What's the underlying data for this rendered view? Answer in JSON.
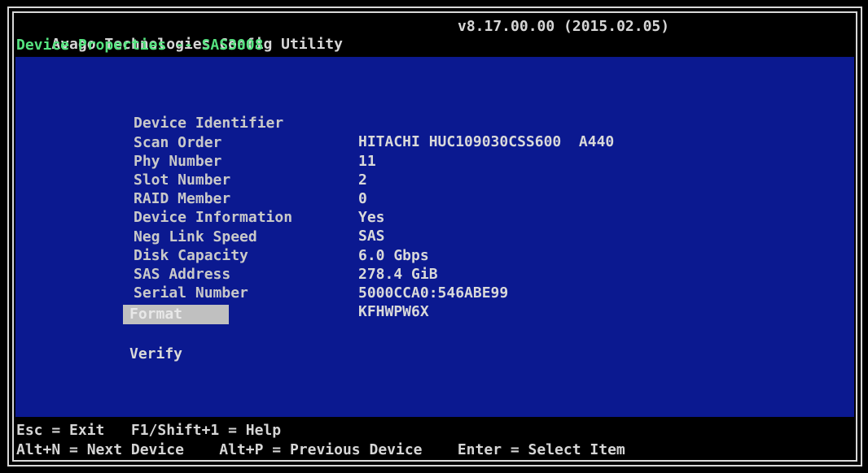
{
  "window": {
    "app_title": "Avago Technologies Config Utility",
    "version": "v8.17.00.00 (2015.02.05)",
    "screen_title": "Device Properties -- SAS3008"
  },
  "properties": [
    {
      "label": "Device Identifier",
      "value": "HITACHI HUC109030CSS600  A440"
    },
    {
      "label": "Scan Order",
      "value": "11"
    },
    {
      "label": "Phy Number",
      "value": "2"
    },
    {
      "label": "Slot Number",
      "value": "0"
    },
    {
      "label": "RAID Member",
      "value": "Yes"
    },
    {
      "label": "Device Information",
      "value": "SAS"
    },
    {
      "label": "Neg Link Speed",
      "value": "6.0 Gbps"
    },
    {
      "label": "Disk Capacity",
      "value": "278.4 GiB"
    },
    {
      "label": "SAS Address",
      "value": "5000CCA0:546ABE99"
    },
    {
      "label": "Serial Number",
      "value": "KFHWPW6X"
    }
  ],
  "actions": {
    "format": "Format",
    "verify": "Verify"
  },
  "help": {
    "line1": "Esc = Exit   F1/Shift+1 = Help",
    "line2": "Alt+N = Next Device    Alt+P = Previous Device    Enter = Select Item"
  },
  "colors": {
    "background": "#000000",
    "panel": "#0b1990",
    "text": "#d6d6d6",
    "screen_title": "#55e37f",
    "selected_item": "#c0c0c0"
  }
}
